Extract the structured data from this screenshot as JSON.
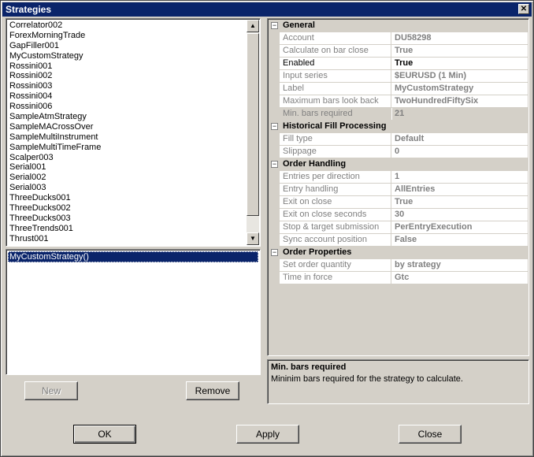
{
  "window": {
    "title": "Strategies",
    "close_glyph": "✕"
  },
  "strategy_list": {
    "items": [
      "Correlator002",
      "ForexMorningTrade",
      "GapFiller001",
      "MyCustomStrategy",
      "Rossini001",
      "Rossini002",
      "Rossini003",
      "Rossini004",
      "Rossini006",
      "SampleAtmStrategy",
      "SampleMACrossOver",
      "SampleMultiInstrument",
      "SampleMultiTimeFrame",
      "Scalper003",
      "Serial001",
      "Serial002",
      "Serial003",
      "ThreeDucks001",
      "ThreeDucks002",
      "ThreeDucks003",
      "ThreeTrends001",
      "Thrust001"
    ],
    "scroll_up_glyph": "▲",
    "scroll_down_glyph": "▼"
  },
  "selected_strategies": {
    "items": [
      "MyCustomStrategy()"
    ]
  },
  "buttons": {
    "new": "New",
    "remove": "Remove",
    "ok": "OK",
    "apply": "Apply",
    "close": "Close"
  },
  "properties": {
    "categories": [
      {
        "name": "General",
        "toggle": "−",
        "rows": [
          {
            "name": "Account",
            "value": "DU58298",
            "editable": false
          },
          {
            "name": "Calculate on bar close",
            "value": "True",
            "editable": false
          },
          {
            "name": "Enabled",
            "value": "True",
            "editable": true
          },
          {
            "name": "Input series",
            "value": "$EURUSD (1 Min)",
            "editable": false
          },
          {
            "name": "Label",
            "value": "MyCustomStrategy",
            "editable": false
          },
          {
            "name": "Maximum bars look back",
            "value": "TwoHundredFiftySix",
            "editable": false
          },
          {
            "name": "Min. bars required",
            "value": "21",
            "editable": false,
            "selected": true
          }
        ]
      },
      {
        "name": "Historical Fill Processing",
        "toggle": "−",
        "rows": [
          {
            "name": "Fill type",
            "value": "Default",
            "editable": false
          },
          {
            "name": "Slippage",
            "value": "0",
            "editable": false
          }
        ]
      },
      {
        "name": "Order Handling",
        "toggle": "−",
        "rows": [
          {
            "name": "Entries per direction",
            "value": "1",
            "editable": false
          },
          {
            "name": "Entry handling",
            "value": "AllEntries",
            "editable": false
          },
          {
            "name": "Exit on close",
            "value": "True",
            "editable": false
          },
          {
            "name": "Exit on close seconds",
            "value": "30",
            "editable": false
          },
          {
            "name": "Stop & target submission",
            "value": "PerEntryExecution",
            "editable": false
          },
          {
            "name": "Sync account position",
            "value": "False",
            "editable": false
          }
        ]
      },
      {
        "name": "Order Properties",
        "toggle": "−",
        "rows": [
          {
            "name": "Set order quantity",
            "value": "by strategy",
            "editable": false
          },
          {
            "name": "Time in force",
            "value": "Gtc",
            "editable": false
          }
        ]
      }
    ]
  },
  "help": {
    "title": "Min. bars required",
    "description": "Mininim bars required for the strategy to calculate."
  }
}
